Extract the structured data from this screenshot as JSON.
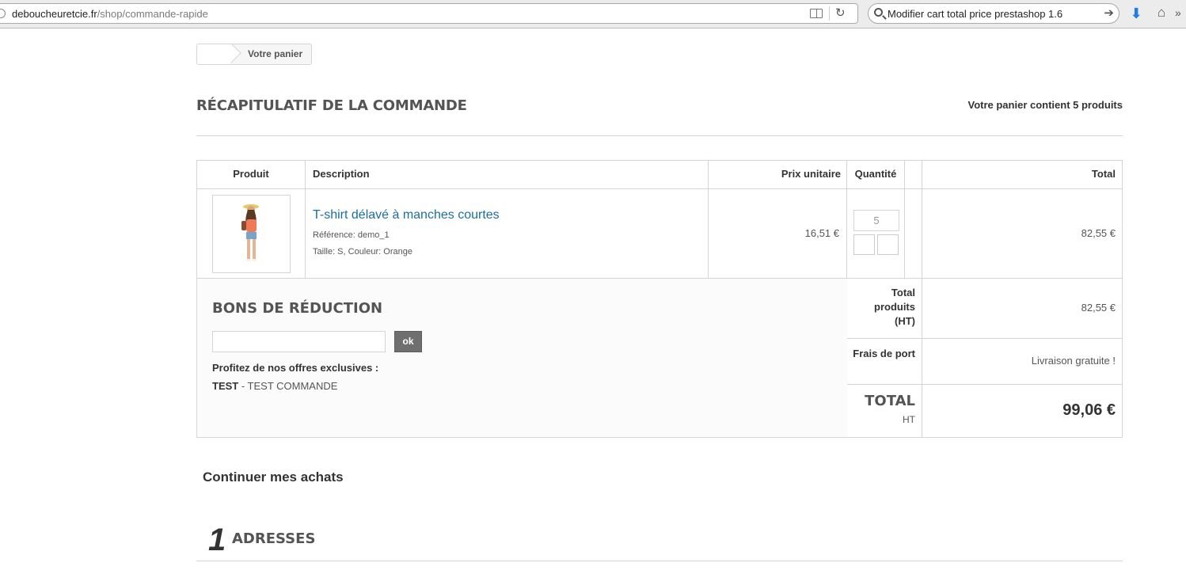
{
  "browser": {
    "url_domain": "deboucheuretcie.fr",
    "url_path": "/shop/commande-rapide",
    "search_query": "Modifier cart total price prestashop 1.6"
  },
  "breadcrumb": {
    "current": "Votre panier"
  },
  "page": {
    "heading": "RÉCAPITULATIF DE LA COMMANDE",
    "cart_count_text": "Votre panier contient 5 produits"
  },
  "cart": {
    "headers": {
      "product": "Produit",
      "description": "Description",
      "unit_price": "Prix unitaire",
      "quantity": "Quantité",
      "total": "Total"
    },
    "items": [
      {
        "name": "T-shirt délavé à manches courtes",
        "reference": "Référence: demo_1",
        "attributes": "Taille: S, Couleur: Orange",
        "unit_price": "16,51 €",
        "quantity": "5",
        "total": "82,55 €"
      }
    ]
  },
  "voucher": {
    "title": "BONS DE RÉDUCTION",
    "ok_label": "ok",
    "offers_title": "Profitez de nos offres exclusives :",
    "offer_code": "TEST",
    "offer_desc": " - TEST COMMANDE"
  },
  "summary": {
    "total_products_label": "Total produits (HT)",
    "total_products_value": "82,55 €",
    "shipping_label": "Frais de port",
    "shipping_value": "Livraison gratuite !",
    "grand_total_label": "TOTAL",
    "grand_total_sub": "HT",
    "grand_total_value": "99,06 €"
  },
  "continue_label": "Continuer mes achats",
  "step": {
    "number": "1",
    "title": "ADRESSES"
  },
  "colors": {
    "link": "#1a6fa0",
    "border": "#d6d4d4",
    "button_dark": "#6f6f6f",
    "download_icon": "#1f7fe0"
  }
}
